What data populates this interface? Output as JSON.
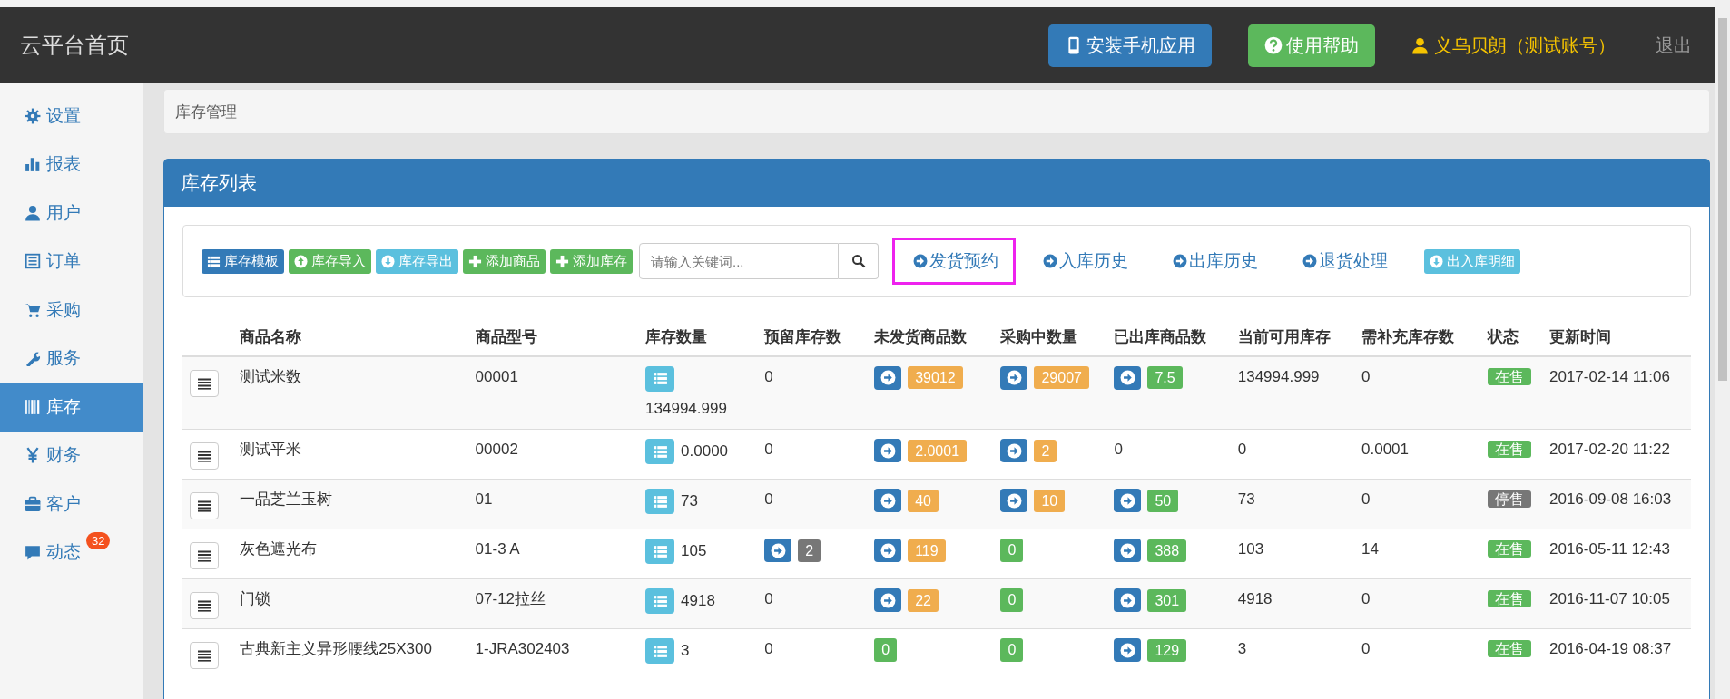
{
  "topbar": {
    "title": "云平台首页",
    "buttons": [
      {
        "label": "安装手机应用",
        "kind": "mobile"
      },
      {
        "label": "使用帮助",
        "kind": "help"
      }
    ],
    "user": "义乌贝朗（测试账号）",
    "logout": "退出"
  },
  "sidebar": {
    "items": [
      {
        "label": "设置",
        "kind": "gear",
        "selected": false
      },
      {
        "label": "报表",
        "kind": "chart",
        "selected": false
      },
      {
        "label": "用户",
        "kind": "user",
        "selected": false
      },
      {
        "label": "订单",
        "kind": "list",
        "selected": false
      },
      {
        "label": "采购",
        "kind": "cart",
        "selected": false
      },
      {
        "label": "服务",
        "kind": "wrench",
        "selected": false
      },
      {
        "label": "库存",
        "kind": "barcode",
        "selected": true
      },
      {
        "label": "财务",
        "kind": "yen",
        "selected": false
      },
      {
        "label": "客户",
        "kind": "briefcase",
        "selected": false
      },
      {
        "label": "动态",
        "kind": "comment",
        "selected": false,
        "badge": "32"
      }
    ]
  },
  "breadcrumb": "库存管理",
  "panel": {
    "title": "库存列表",
    "toolbar": {
      "buttons": [
        {
          "label": "库存模板",
          "kind": "template"
        },
        {
          "label": "库存导入",
          "kind": "import"
        },
        {
          "label": "库存导出",
          "kind": "export"
        },
        {
          "label": "添加商品",
          "kind": "add"
        },
        {
          "label": "添加库存",
          "kind": "add"
        }
      ],
      "search": {
        "placeholder": "请输入关键词..."
      },
      "links": [
        {
          "label": "发货预约",
          "highlighted": true
        },
        {
          "label": "入库历史",
          "highlighted": false
        },
        {
          "label": "出库历史",
          "highlighted": false
        },
        {
          "label": "退货处理",
          "highlighted": false
        }
      ],
      "detail_button": {
        "label": "出入库明细"
      }
    },
    "table": {
      "columns": [
        "商品名称",
        "商品型号",
        "库存数量",
        "预留库存数",
        "未发货商品数",
        "采购中数量",
        "已出库商品数",
        "当前可用库存",
        "需补充库存数",
        "状态",
        "更新时间"
      ],
      "rows": [
        {
          "name": "测试米数",
          "model": "00001",
          "stock": "134994.999",
          "reserved": {
            "kind": "plain",
            "value": "0"
          },
          "unshipped": {
            "kind": "arrow-badge",
            "value": "39012",
            "color": "#f0ad4e"
          },
          "purchasing": {
            "kind": "arrow-badge",
            "value": "29007",
            "color": "#f0ad4e"
          },
          "shipped": {
            "kind": "arrow-badge",
            "value": "7.5",
            "color": "#5cb85c"
          },
          "available": "134994.999",
          "replenish": "0",
          "status": {
            "label": "在售",
            "color": "#5cb85c"
          },
          "updated": "2017-02-14 11:06"
        },
        {
          "name": "测试平米",
          "model": "00002",
          "stock": "0.0000",
          "reserved": {
            "kind": "plain",
            "value": "0"
          },
          "unshipped": {
            "kind": "arrow-badge",
            "value": "2.0001",
            "color": "#f0ad4e"
          },
          "purchasing": {
            "kind": "arrow-badge",
            "value": "2",
            "color": "#f0ad4e"
          },
          "shipped": {
            "kind": "plain",
            "value": "0"
          },
          "available": "0",
          "replenish": "0.0001",
          "status": {
            "label": "在售",
            "color": "#5cb85c"
          },
          "updated": "2017-02-20 11:22"
        },
        {
          "name": "一品芝兰玉树",
          "model": "01",
          "stock": "73",
          "reserved": {
            "kind": "plain",
            "value": "0"
          },
          "unshipped": {
            "kind": "arrow-badge",
            "value": "40",
            "color": "#f0ad4e"
          },
          "purchasing": {
            "kind": "arrow-badge",
            "value": "10",
            "color": "#f0ad4e"
          },
          "shipped": {
            "kind": "arrow-badge",
            "value": "50",
            "color": "#5cb85c"
          },
          "available": "73",
          "replenish": "0",
          "status": {
            "label": "停售",
            "color": "#777777"
          },
          "updated": "2016-09-08 16:03"
        },
        {
          "name": "灰色遮光布",
          "model": "01-3 A",
          "stock": "105",
          "reserved": {
            "kind": "arrow-badge",
            "value": "2",
            "color": "#777777"
          },
          "unshipped": {
            "kind": "arrow-badge",
            "value": "119",
            "color": "#f0ad4e"
          },
          "purchasing": {
            "kind": "badge",
            "value": "0",
            "color": "#5cb85c"
          },
          "shipped": {
            "kind": "arrow-badge",
            "value": "388",
            "color": "#5cb85c"
          },
          "available": "103",
          "replenish": "14",
          "status": {
            "label": "在售",
            "color": "#5cb85c"
          },
          "updated": "2016-05-11 12:43"
        },
        {
          "name": "门锁",
          "model": "07-12拉丝",
          "stock": "4918",
          "reserved": {
            "kind": "plain",
            "value": "0"
          },
          "unshipped": {
            "kind": "arrow-badge",
            "value": "22",
            "color": "#f0ad4e"
          },
          "purchasing": {
            "kind": "badge",
            "value": "0",
            "color": "#5cb85c"
          },
          "shipped": {
            "kind": "arrow-badge",
            "value": "301",
            "color": "#5cb85c"
          },
          "available": "4918",
          "replenish": "0",
          "status": {
            "label": "在售",
            "color": "#5cb85c"
          },
          "updated": "2016-11-07 10:05"
        },
        {
          "name": "古典新主义异形腰线25X300",
          "model": "1-JRA302403",
          "stock": "3",
          "reserved": {
            "kind": "plain",
            "value": "0"
          },
          "unshipped": {
            "kind": "badge",
            "value": "0",
            "color": "#5cb85c"
          },
          "purchasing": {
            "kind": "badge",
            "value": "0",
            "color": "#5cb85c"
          },
          "shipped": {
            "kind": "arrow-badge",
            "value": "129",
            "color": "#5cb85c"
          },
          "available": "3",
          "replenish": "0",
          "status": {
            "label": "在售",
            "color": "#5cb85c"
          },
          "updated": "2016-04-19 08:37"
        }
      ]
    }
  }
}
